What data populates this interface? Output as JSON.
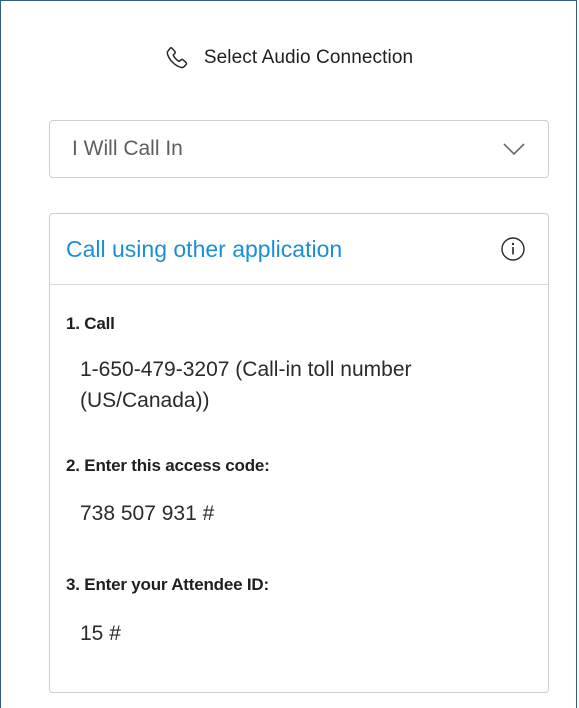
{
  "header": {
    "icon": "phone-icon",
    "title": "Select Audio Connection"
  },
  "audio_select": {
    "selected": "I Will Call In",
    "icon": "chevron-down-icon"
  },
  "card": {
    "link_label": "Call using other application",
    "info_icon": "info-icon",
    "steps": [
      {
        "label": "1. Call",
        "value": "1-650-479-3207 (Call-in toll number (US/Canada))"
      },
      {
        "label": "2. Enter this access code:",
        "value": "738 507 931 #"
      },
      {
        "label": "3. Enter your Attendee ID:",
        "value": "15 #"
      }
    ]
  },
  "colors": {
    "accent": "#1b8fd4",
    "window_border": "#2f5b8f",
    "field_border": "#cfcfcf"
  }
}
